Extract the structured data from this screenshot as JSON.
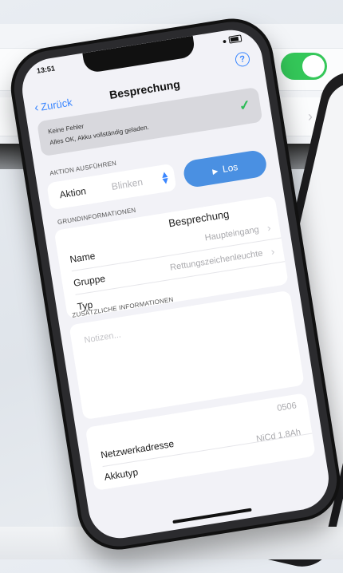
{
  "status_bar": {
    "time": "13:51"
  },
  "nav": {
    "back_label": "Zurück",
    "title": "Besprechung"
  },
  "status": {
    "line1": "Keine Fehler",
    "line2": "Alles OK, Akku vollständig geladen."
  },
  "action_section": {
    "header": "AKTION AUSFÜHREN",
    "label": "Aktion",
    "value": "Blinken",
    "button_label": "Los"
  },
  "basic_section": {
    "header": "GRUNDINFORMATIONEN",
    "title_value": "Besprechung",
    "rows": [
      {
        "label": "Name",
        "value": "Haupteingang"
      },
      {
        "label": "Gruppe",
        "value": "Rettungszeichenleuchte"
      },
      {
        "label": "Typ",
        "value": ""
      }
    ]
  },
  "extra_section": {
    "header": "ZUSÄTZLICHE INFORMATIONEN",
    "notes_placeholder": "Notizen...",
    "network_label": "Netzwerkadresse",
    "network_value": "0506",
    "battery_label": "Akkutyp",
    "battery_value": "NiCd 1.8Ah"
  },
  "colors": {
    "accent": "#3a86ff",
    "ok_green": "#2dbb57",
    "toggle_green": "#34c759"
  }
}
